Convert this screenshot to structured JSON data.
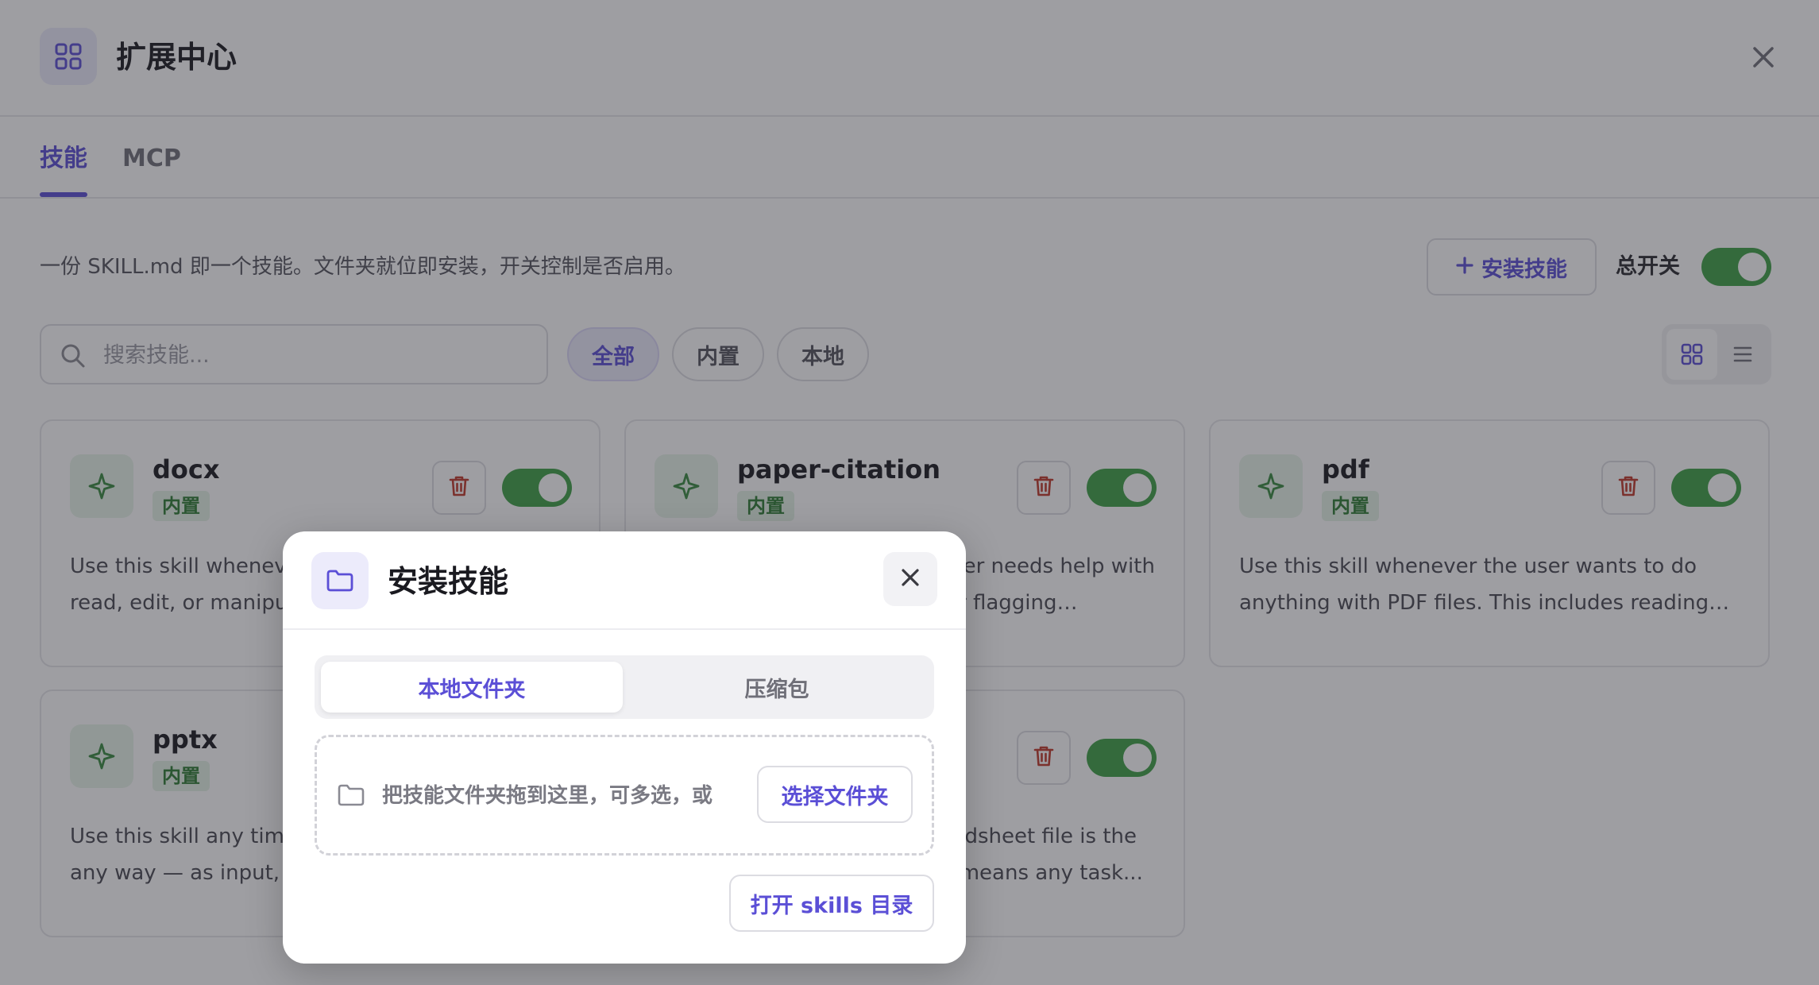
{
  "header": {
    "title": "扩展中心"
  },
  "tabs": [
    {
      "label": "技能"
    },
    {
      "label": "MCP"
    }
  ],
  "toolbar": {
    "description": "一份 SKILL.md 即一个技能。文件夹就位即安装，开关控制是否启用。",
    "install_label": "安装技能",
    "install_icon": "plus-icon",
    "master_switch_label": "总开关",
    "master_switch_on": true
  },
  "search": {
    "placeholder": "搜索技能..."
  },
  "filters": [
    {
      "label": "全部",
      "selected": true
    },
    {
      "label": "内置"
    },
    {
      "label": "本地"
    }
  ],
  "view_mode": "grid",
  "skills": [
    {
      "name": "docx",
      "badge": "内置",
      "enabled": true,
      "description": "Use this skill whenever the user wants to create, read, edit, or manipulate Word documents."
    },
    {
      "name": "paper-citation",
      "badge": "内置",
      "enabled": true,
      "description": "Use this skill whenever the user needs help with references, citation checks, or flagging suspected fake..."
    },
    {
      "name": "pdf",
      "badge": "内置",
      "enabled": true,
      "description": "Use this skill whenever the user wants to do anything with PDF files. This includes reading o..."
    },
    {
      "name": "pptx",
      "badge": "内置",
      "enabled": true,
      "description": "Use this skill any time a .pptx file is involved in any way — as input, output, or both."
    },
    {
      "name": "",
      "badge": "",
      "enabled": true,
      "description": "Use this skill any time a spreadsheet file is the primary input or output. This means any task..."
    }
  ],
  "modal": {
    "title": "安装技能",
    "tabs": [
      {
        "label": "本地文件夹",
        "selected": true
      },
      {
        "label": "压缩包"
      }
    ],
    "dropzone_text": "把技能文件夹拖到这里，可多选，或",
    "choose_folder_label": "选择文件夹",
    "open_dir_label": "打开 skills 目录"
  },
  "colors": {
    "accent": "#5b4fd6",
    "toggle_on": "#3fa046",
    "badge_bg": "#e4f2e5",
    "badge_text": "#2e7d34",
    "delete_icon": "#c0392b"
  }
}
